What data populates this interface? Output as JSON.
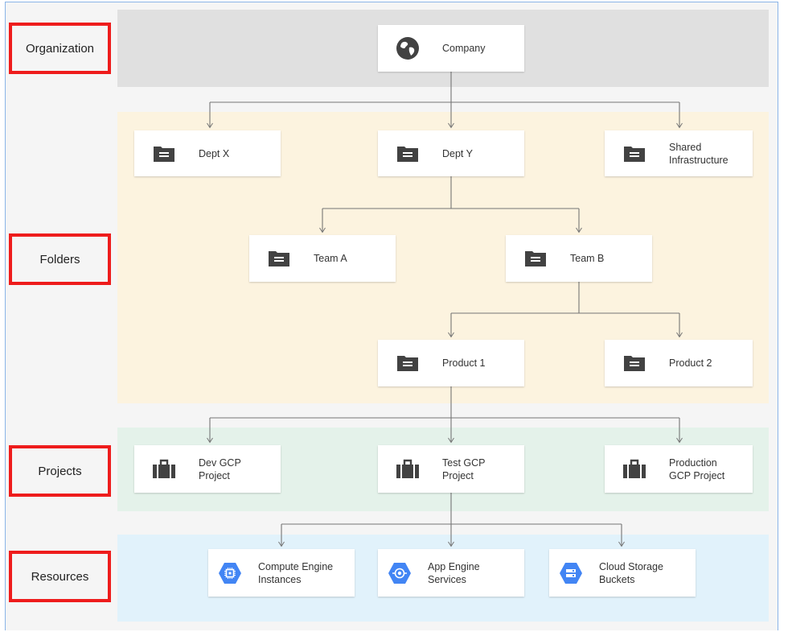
{
  "tiers": {
    "organization": "Organization",
    "folders": "Folders",
    "projects": "Projects",
    "resources": "Resources"
  },
  "nodes": {
    "company": "Company",
    "dept_x": "Dept X",
    "dept_y": "Dept Y",
    "shared_infra_l1": "Shared",
    "shared_infra_l2": "Infrastructure",
    "team_a": "Team A",
    "team_b": "Team B",
    "product_1": "Product 1",
    "product_2": "Product 2",
    "dev_l1": "Dev GCP",
    "dev_l2": "Project",
    "test_l1": "Test GCP",
    "test_l2": "Project",
    "prod_l1": "Production",
    "prod_l2": "GCP Project",
    "compute_l1": "Compute Engine",
    "compute_l2": "Instances",
    "appengine_l1": "App Engine",
    "appengine_l2": "Services",
    "storage_l1": "Cloud Storage",
    "storage_l2": "Buckets"
  },
  "colors": {
    "tier_border": "#ee1c1c",
    "org_band": "#e0e0e0",
    "folders_band": "#fcf3df",
    "projects_band": "#e4f2ea",
    "resources_band": "#e1f2fb",
    "gcp_blue": "#4285f4",
    "icon_dark": "#424242",
    "connector": "#757575"
  },
  "icons": {
    "organization": "globe-icon",
    "folder": "folder-icon",
    "project": "briefcase-icon",
    "compute": "compute-engine-icon",
    "appengine": "app-engine-icon",
    "storage": "cloud-storage-icon"
  }
}
